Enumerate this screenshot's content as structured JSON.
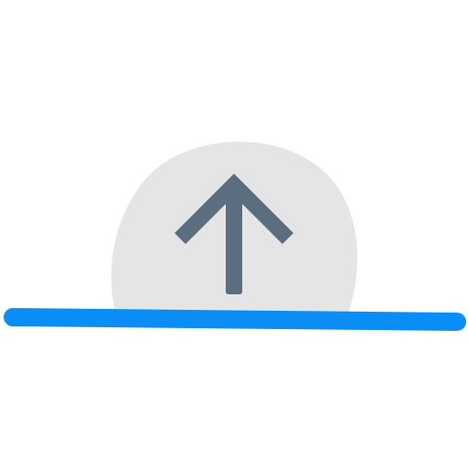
{
  "icon": {
    "name": "upload-arrow-icon",
    "semantic": "arrow-up-over-horizon",
    "colors": {
      "background": "#ffffff",
      "circle": "#e5e5e5",
      "arrow": "#5a6e7f",
      "horizon": "#0a8ef5"
    }
  }
}
